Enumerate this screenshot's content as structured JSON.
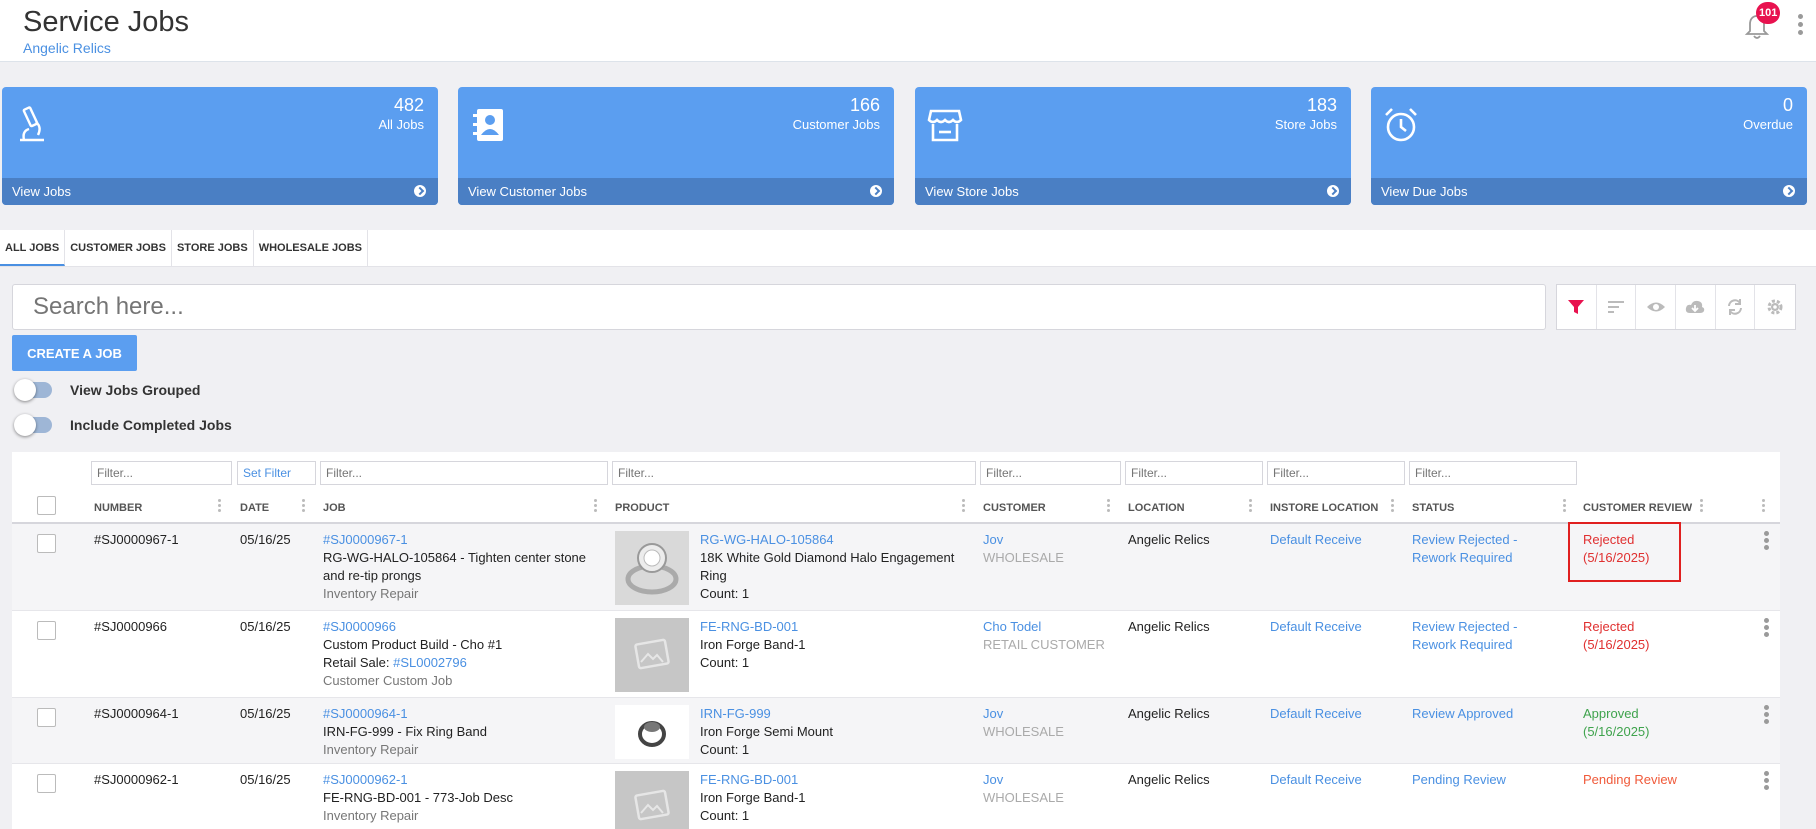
{
  "header": {
    "title": "Service Jobs",
    "subtitle": "Angelic Relics",
    "notification_count": "101"
  },
  "cards": [
    {
      "count": "482",
      "label": "All Jobs",
      "link": "View Jobs",
      "icon": "microscope-icon"
    },
    {
      "count": "166",
      "label": "Customer Jobs",
      "link": "View Customer Jobs",
      "icon": "contact-book-icon"
    },
    {
      "count": "183",
      "label": "Store Jobs",
      "link": "View Store Jobs",
      "icon": "storefront-icon"
    },
    {
      "count": "0",
      "label": "Overdue",
      "link": "View Due Jobs",
      "icon": "alarm-clock-icon"
    }
  ],
  "tabs": [
    {
      "label": "ALL JOBS",
      "active": true
    },
    {
      "label": "CUSTOMER JOBS",
      "active": false
    },
    {
      "label": "STORE JOBS",
      "active": false
    },
    {
      "label": "WHOLESALE JOBS",
      "active": false
    }
  ],
  "search": {
    "placeholder": "Search here..."
  },
  "toolbar": [
    "filter-icon",
    "sort-icon",
    "eye-icon",
    "cloud-download-icon",
    "sync-icon",
    "gear-icon"
  ],
  "create_button": "CREATE A JOB",
  "toggles": {
    "grouped": "View Jobs Grouped",
    "completed": "Include Completed Jobs"
  },
  "filters": {
    "placeholder": "Filter...",
    "set_filter": "Set Filter"
  },
  "columns": [
    "NUMBER",
    "DATE",
    "JOB",
    "PRODUCT",
    "CUSTOMER",
    "LOCATION",
    "INSTORE LOCATION",
    "STATUS",
    "CUSTOMER REVIEW"
  ],
  "rows": [
    {
      "number": "#SJ0000967-1",
      "date": "05/16/25",
      "job_link": "#SJ0000967-1",
      "job_desc": "RG-WG-HALO-105864 - Tighten center stone and re-tip prongs",
      "job_type": "Inventory Repair",
      "product_sku": "RG-WG-HALO-105864",
      "product_name": "18K White Gold Diamond Halo Engagement Ring",
      "product_count": "Count: 1",
      "customer": "Jov",
      "customer_type": "WHOLESALE",
      "location": "Angelic Relics",
      "instore": "Default Receive",
      "status": "Review Rejected - Rework Required",
      "review": "Rejected",
      "review_date": "(5/16/2025)",
      "review_color": "#e03030"
    },
    {
      "number": "#SJ0000966",
      "date": "05/16/25",
      "job_link": "#SJ0000966",
      "job_desc": "Custom Product Build - Cho #1",
      "retail_sale_label": "Retail Sale:",
      "retail_sale_link": "#SL0002796",
      "job_type": "Customer Custom Job",
      "product_sku": "FE-RNG-BD-001",
      "product_name": "Iron Forge Band-1",
      "product_count": "Count: 1",
      "customer": "Cho Todel",
      "customer_type": "RETAIL CUSTOMER",
      "location": "Angelic Relics",
      "instore": "Default Receive",
      "status": "Review Rejected - Rework Required",
      "review": "Rejected",
      "review_date": "(5/16/2025)",
      "review_color": "#e03030"
    },
    {
      "number": "#SJ0000964-1",
      "date": "05/16/25",
      "job_link": "#SJ0000964-1",
      "job_desc": "IRN-FG-999 - Fix Ring Band",
      "job_type": "Inventory Repair",
      "product_sku": "IRN-FG-999",
      "product_name": "Iron Forge Semi Mount",
      "product_count": "Count: 1",
      "customer": "Jov",
      "customer_type": "WHOLESALE",
      "location": "Angelic Relics",
      "instore": "Default Receive",
      "status": "Review Approved",
      "review": "Approved",
      "review_date": "(5/16/2025)",
      "review_color": "#3fa34d"
    },
    {
      "number": "#SJ0000962-1",
      "date": "05/16/25",
      "job_link": "#SJ0000962-1",
      "job_desc": "FE-RNG-BD-001 - 773-Job Desc",
      "job_type": "Inventory Repair",
      "product_sku": "FE-RNG-BD-001",
      "product_name": "Iron Forge Band-1",
      "product_count": "Count: 1",
      "customer": "Jov",
      "customer_type": "WHOLESALE",
      "location": "Angelic Relics",
      "instore": "Default Receive",
      "status": "Pending Review",
      "review": "Pending Review",
      "review_date": "",
      "review_color": "#f05a3a"
    }
  ]
}
